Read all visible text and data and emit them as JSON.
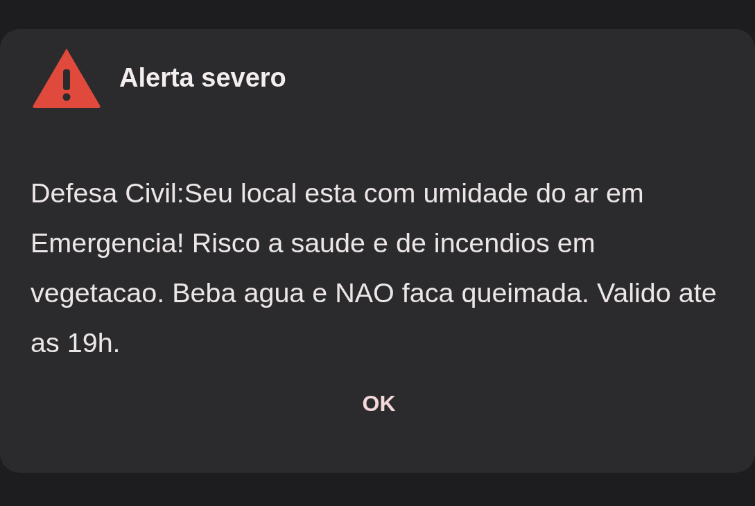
{
  "dialog": {
    "title": "Alerta severo",
    "message": "Defesa Civil:Seu local esta com umidade do ar em Emergencia! Risco a saude e de incendios em vegetacao. Beba agua e NAO faca queimada. Valido ate as 19h.",
    "buttons": [
      "OK"
    ]
  }
}
